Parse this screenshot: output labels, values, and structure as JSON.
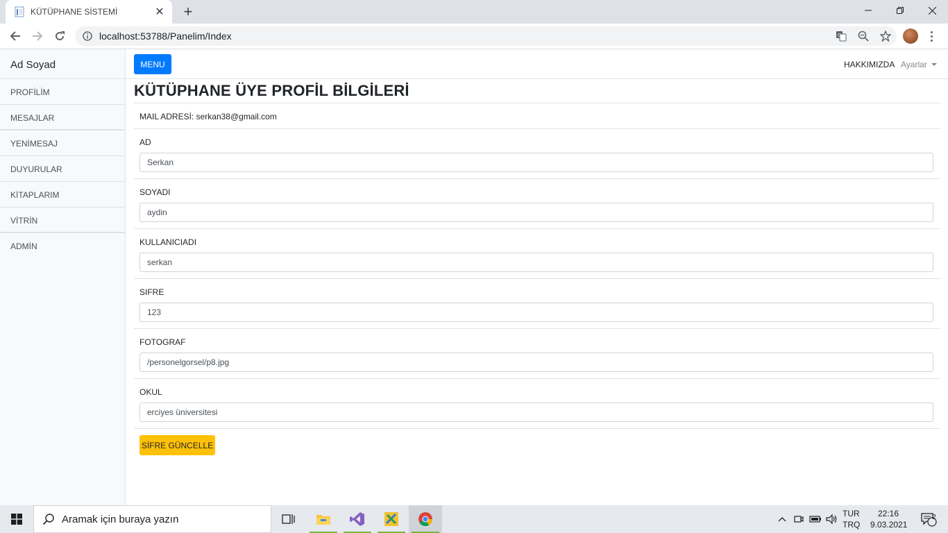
{
  "browser": {
    "tab_title": "KÜTÜPHANE SİSTEMİ",
    "url": "localhost:53788/Panelim/Index"
  },
  "sidebar": {
    "heading": "Ad Soyad",
    "items": [
      "PROFİLİM",
      "MESAJLAR",
      "YENİMESAJ",
      "DUYURULAR",
      "KİTAPLARIM",
      "VİTRİN",
      "ADMİN"
    ]
  },
  "topnav": {
    "menu_label": "MENU",
    "about_label": "HAKKIMIZDA",
    "settings_label": "Ayarlar"
  },
  "profile": {
    "title": "KÜTÜPHANE ÜYE PROFİL BİLGİLERİ",
    "mail_label": "MAIL ADRESİ:",
    "mail_value": "serkan38@gmail.com",
    "fields": [
      {
        "label": "AD",
        "value": "Serkan"
      },
      {
        "label": "SOYADI",
        "value": "aydin"
      },
      {
        "label": "KULLANICIADI",
        "value": "serkan"
      },
      {
        "label": "SIFRE",
        "value": "123"
      },
      {
        "label": "FOTOGRAF",
        "value": "/personelgorsel/p8.jpg"
      },
      {
        "label": "OKUL",
        "value": "erciyes üniversitesi"
      }
    ],
    "submit_label": "SİFRE GÜNCELLE"
  },
  "taskbar": {
    "search_placeholder": "Aramak için buraya yazın",
    "lang_top": "TUR",
    "lang_bottom": "TRQ",
    "time": "22:16",
    "date": "9.03.2021",
    "notification_count": "2"
  },
  "colors": {
    "menu_button": "#007bff",
    "update_button": "#ffc107",
    "sidebar_bg": "#f8f9fa"
  }
}
